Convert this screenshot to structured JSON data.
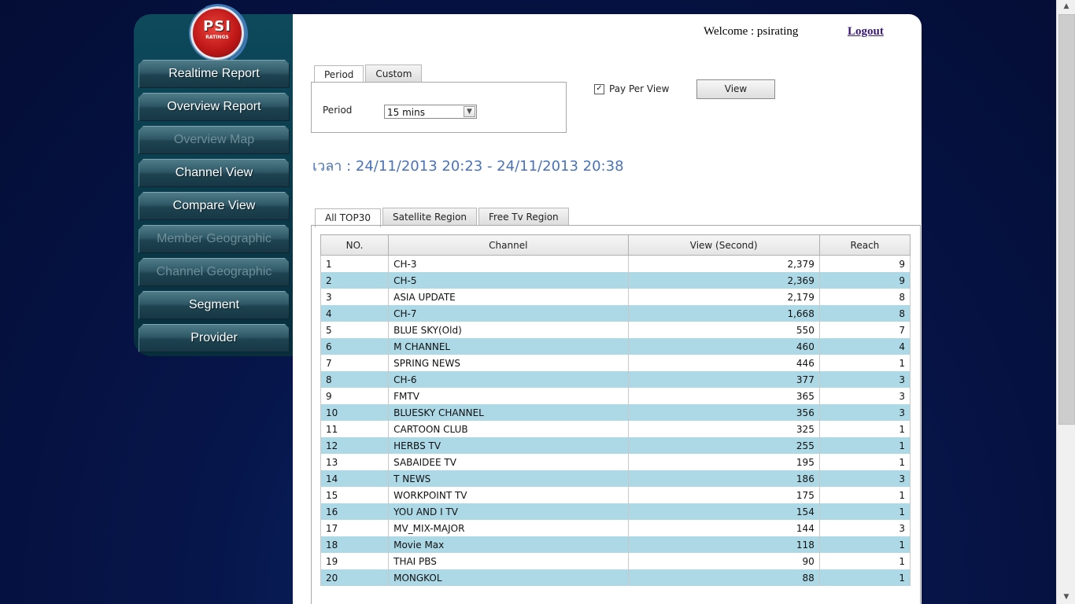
{
  "logo": {
    "text": "PSI",
    "subtext": "RATINGS"
  },
  "nav": [
    {
      "label": "Realtime Report",
      "enabled": true
    },
    {
      "label": "Overview Report",
      "enabled": true
    },
    {
      "label": "Overview Map",
      "enabled": false
    },
    {
      "label": "Channel View",
      "enabled": true
    },
    {
      "label": "Compare View",
      "enabled": true
    },
    {
      "label": "Member Geographic",
      "enabled": false
    },
    {
      "label": "Channel Geographic",
      "enabled": false
    },
    {
      "label": "Segment",
      "enabled": true
    },
    {
      "label": "Provider",
      "enabled": true
    }
  ],
  "header": {
    "welcome": "Welcome :  psirating",
    "logout": "Logout"
  },
  "period_tabs": {
    "period": "Period",
    "custom": "Custom"
  },
  "period_form": {
    "label": "Period",
    "selected": "15 mins"
  },
  "pay_per_view": {
    "label": "Pay Per View",
    "checked": true
  },
  "view_button": "View",
  "time_range": "เวลา : 24/11/2013 20:23 - 24/11/2013 20:38",
  "region_tabs": {
    "all": "All TOP30",
    "satellite": "Satellite Region",
    "freetv": "Free Tv Region"
  },
  "table": {
    "headers": [
      "NO.",
      "Channel",
      "View (Second)",
      "Reach"
    ],
    "rows": [
      [
        "1",
        "CH-3",
        "2,379",
        "9"
      ],
      [
        "2",
        "CH-5",
        "2,369",
        "9"
      ],
      [
        "3",
        "ASIA UPDATE",
        "2,179",
        "8"
      ],
      [
        "4",
        "CH-7",
        "1,668",
        "8"
      ],
      [
        "5",
        "BLUE SKY(Old)",
        "550",
        "7"
      ],
      [
        "6",
        "M CHANNEL",
        "460",
        "4"
      ],
      [
        "7",
        "SPRING NEWS",
        "446",
        "1"
      ],
      [
        "8",
        "CH-6",
        "377",
        "3"
      ],
      [
        "9",
        "FMTV",
        "365",
        "3"
      ],
      [
        "10",
        "BLUESKY CHANNEL",
        "356",
        "3"
      ],
      [
        "11",
        "CARTOON CLUB",
        "325",
        "1"
      ],
      [
        "12",
        "HERBS TV",
        "255",
        "1"
      ],
      [
        "13",
        "SABAIDEE TV",
        "195",
        "1"
      ],
      [
        "14",
        "T NEWS",
        "186",
        "3"
      ],
      [
        "15",
        "WORKPOINT TV",
        "175",
        "1"
      ],
      [
        "16",
        "YOU AND I TV",
        "154",
        "1"
      ],
      [
        "17",
        "MV_MIX-MAJOR",
        "144",
        "3"
      ],
      [
        "18",
        "Movie Max",
        "118",
        "1"
      ],
      [
        "19",
        "THAI PBS",
        "90",
        "1"
      ],
      [
        "20",
        "MONGKOL",
        "88",
        "1"
      ]
    ]
  },
  "colors": {
    "alt_row": "#add8e6",
    "time_text": "#4a73b8",
    "nav_bg": "#0d4a5c"
  }
}
